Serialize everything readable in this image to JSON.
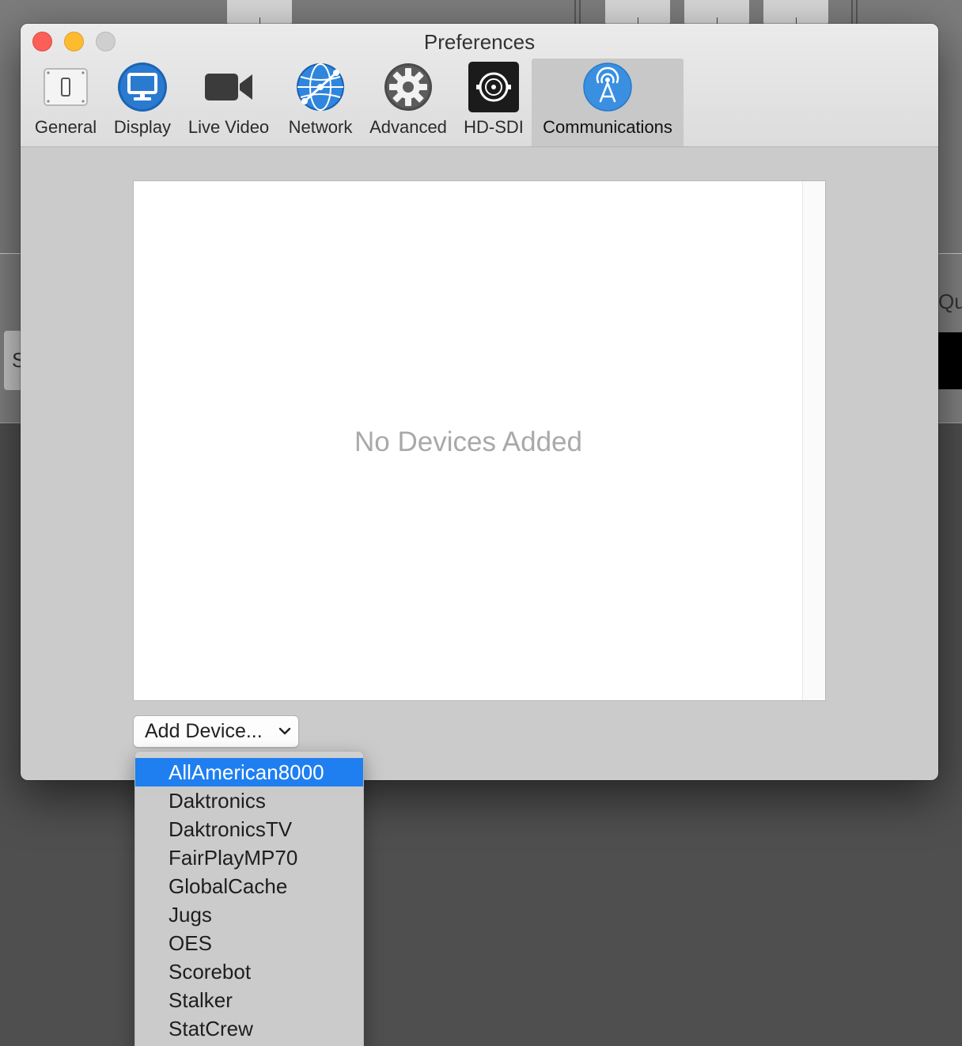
{
  "background": {
    "side_tab_letter": "S",
    "right_text": "Qu"
  },
  "window": {
    "title": "Preferences",
    "controls": [
      "close",
      "minimize",
      "zoom"
    ]
  },
  "toolbar": {
    "selected": "Communications",
    "tabs": [
      {
        "label": "General",
        "icon": "switch-icon"
      },
      {
        "label": "Display",
        "icon": "display-icon"
      },
      {
        "label": "Live Video",
        "icon": "video-camera-icon"
      },
      {
        "label": "Network",
        "icon": "globe-icon"
      },
      {
        "label": "Advanced",
        "icon": "gear-icon"
      },
      {
        "label": "HD-SDI",
        "icon": "bnc-connector-icon"
      },
      {
        "label": "Communications",
        "icon": "antenna-icon"
      }
    ]
  },
  "devices": {
    "empty_message": "No Devices Added",
    "items": []
  },
  "add_device": {
    "label": "Add Device...",
    "menu_items": [
      "AllAmerican8000",
      "Daktronics",
      "DaktronicsTV",
      "FairPlayMP70",
      "GlobalCache",
      "Jugs",
      "OES",
      "Scorebot",
      "Stalker",
      "StatCrew"
    ],
    "highlighted": "AllAmerican8000"
  },
  "colors": {
    "accent": "#1f7ff0",
    "close": "#fc5f57",
    "minimize": "#fdbc2e",
    "zoom": "#cfcfcf",
    "communications_icon": "#3a8fe0"
  }
}
